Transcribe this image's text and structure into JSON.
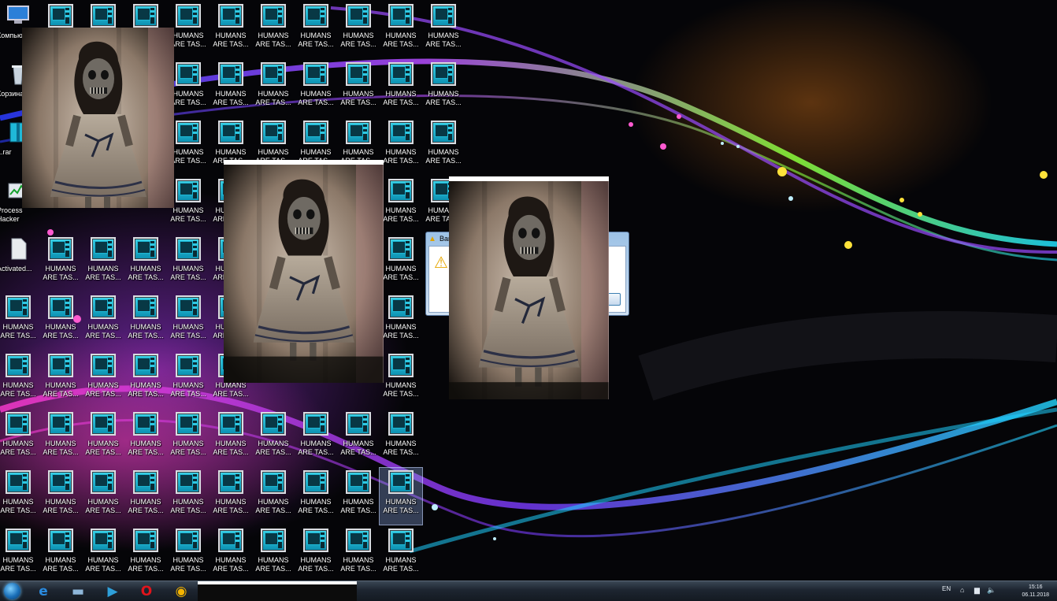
{
  "desktop": {
    "sys_icons": [
      {
        "label": "Компьют..."
      },
      {
        "label": "Корзина"
      },
      {
        "label": "1.rar"
      },
      {
        "label": "Process\nHacker"
      },
      {
        "label": "Activated..."
      }
    ],
    "shortcut_label": "HUMANS\nARE TAS...",
    "shortcut_icon": "humans-are-tasty-exe-icon",
    "shortcut_rows": [
      [
        1,
        2,
        3,
        4,
        5,
        6,
        7,
        8,
        9,
        10
      ],
      [
        4,
        5,
        6,
        7,
        8,
        9,
        10
      ],
      [
        4,
        5,
        6,
        7,
        8,
        9,
        10
      ],
      [
        4,
        5,
        9,
        10
      ],
      [
        1,
        2,
        3,
        4,
        5,
        9
      ],
      [
        0,
        1,
        2,
        3,
        4,
        5,
        9
      ],
      [
        0,
        1,
        2,
        3,
        4,
        5,
        9
      ],
      [
        0,
        1,
        2,
        3,
        4,
        5,
        6,
        7,
        8,
        9
      ],
      [
        0,
        1,
        2,
        3,
        4,
        5,
        6,
        7,
        8,
        9
      ],
      [
        0,
        1,
        2,
        3,
        4,
        5,
        6,
        7,
        8,
        9
      ]
    ],
    "selected_shortcut": "row 8 col 9"
  },
  "error_dialog": {
    "title": "Ваш...",
    "icon": "warning-icon",
    "button_label": "ть"
  },
  "taskbar": {
    "pinned": [
      {
        "name": "internet-explorer-icon",
        "glyph": "e"
      },
      {
        "name": "file-explorer-icon",
        "glyph": "▬"
      },
      {
        "name": "media-player-icon",
        "glyph": "▶"
      },
      {
        "name": "opera-icon",
        "glyph": "O"
      },
      {
        "name": "chrome-icon",
        "glyph": "◉"
      }
    ],
    "tray": {
      "language": "EN",
      "time": "15:16",
      "date": "06.11.2018"
    }
  },
  "colors": {
    "accent_cyan": "#2fc9e3",
    "taskbar_dark": "#1d2530"
  }
}
